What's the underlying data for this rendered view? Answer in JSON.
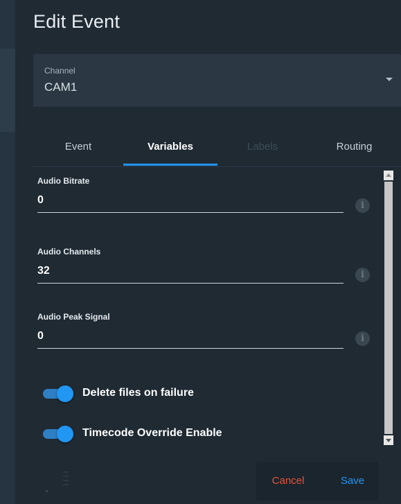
{
  "dialog": {
    "title": "Edit Event"
  },
  "channel_select": {
    "label": "Channel",
    "value": "CAM1"
  },
  "tabs": [
    {
      "label": "Event",
      "state": "normal"
    },
    {
      "label": "Variables",
      "state": "active"
    },
    {
      "label": "Labels",
      "state": "disabled"
    },
    {
      "label": "Routing",
      "state": "normal"
    }
  ],
  "fields": [
    {
      "label": "Audio Bitrate",
      "value": "0",
      "icon": "info-icon"
    },
    {
      "label": "Audio Channels",
      "value": "32",
      "icon": "info-icon"
    },
    {
      "label": "Audio Peak Signal",
      "value": "0",
      "icon": "info-icon"
    }
  ],
  "info_glyph": "i",
  "toggles": [
    {
      "label": "Delete files on failure",
      "on": true
    },
    {
      "label": "Timecode Override Enable",
      "on": true
    }
  ],
  "actions": {
    "cancel_label": "Cancel",
    "save_label": "Save"
  },
  "colors": {
    "background": "#1f2a33",
    "accent": "#2196f3",
    "cancel": "#e5533b",
    "select_bg": "#2b3843"
  }
}
